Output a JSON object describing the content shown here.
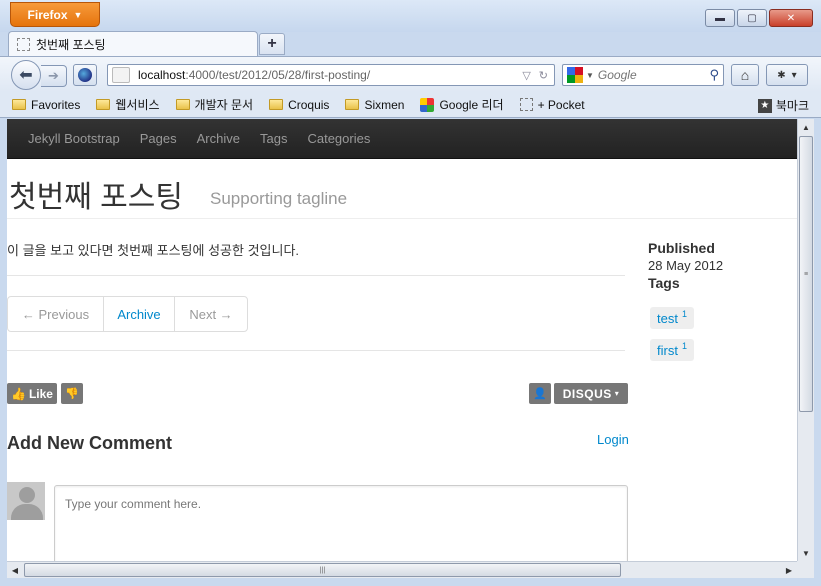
{
  "browser": {
    "menu_button": "Firefox",
    "tab_title": "첫번째 포스팅",
    "new_tab": "+",
    "url_host": "localhost",
    "url_path": ":4000/test/2012/05/28/first-posting/",
    "search_placeholder": "Google",
    "window_controls": {
      "minimize": "▬",
      "maximize": "▢",
      "close": "✕"
    }
  },
  "bookmarks": {
    "items": [
      {
        "label": "Favorites",
        "icon": "folder-icon"
      },
      {
        "label": "웹서비스",
        "icon": "folder-icon"
      },
      {
        "label": "개발자 문서",
        "icon": "folder-icon"
      },
      {
        "label": "Croquis",
        "icon": "folder-icon"
      },
      {
        "label": "Sixmen",
        "icon": "folder-icon"
      },
      {
        "label": "Google 리더",
        "icon": "google-reader-icon"
      },
      {
        "label": "+ Pocket",
        "icon": "pocket-icon"
      }
    ],
    "right_label": "북마크"
  },
  "site": {
    "brand": "Jekyll Bootstrap",
    "nav": [
      "Pages",
      "Archive",
      "Tags",
      "Categories"
    ]
  },
  "post": {
    "title": "첫번째 포스팅",
    "tagline": "Supporting tagline",
    "body": "이 글을 보고 있다면 첫번째 포스팅에 성공한 것입니다.",
    "pager": {
      "prev": "← Previous",
      "archive": "Archive",
      "next": "Next →"
    }
  },
  "sidebar": {
    "published_label": "Published",
    "date": "28 May 2012",
    "tags_label": "Tags",
    "tags": [
      {
        "name": "test",
        "count": "1"
      },
      {
        "name": "first",
        "count": "1"
      }
    ]
  },
  "comments": {
    "like": "Like",
    "disqus": "DISQUS",
    "heading": "Add New Comment",
    "login": "Login",
    "placeholder": "Type your comment here."
  }
}
